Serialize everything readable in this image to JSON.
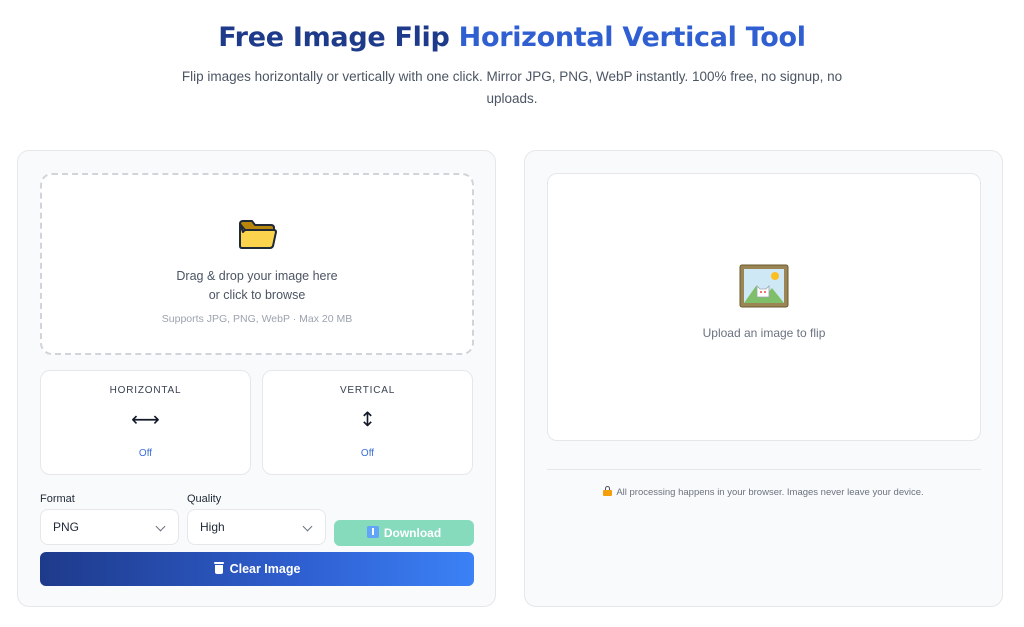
{
  "header": {
    "title_part1": "Free Image Flip ",
    "title_part2": "Horizontal Vertical Tool",
    "subtitle": "Flip images horizontally or vertically with one click. Mirror JPG, PNG, WebP instantly. 100% free, no signup, no uploads."
  },
  "upload": {
    "icon": "folder-icon",
    "line1": "Drag & drop your image here",
    "line2": "or click to browse",
    "hint": "Supports JPG, PNG, WebP · Max 20 MB"
  },
  "flip_options": [
    {
      "label": "HORIZONTAL",
      "arrow": "⟷",
      "state": "Off",
      "icon": "horizontal-arrow-icon"
    },
    {
      "label": "VERTICAL",
      "arrow": "↕",
      "state": "Off",
      "icon": "vertical-arrow-icon"
    }
  ],
  "format": {
    "label": "Format",
    "value": "PNG"
  },
  "quality": {
    "label": "Quality",
    "value": "High"
  },
  "buttons": {
    "download": "Download",
    "clear": "Clear Image"
  },
  "preview": {
    "icon": "picture-frame-icon",
    "placeholder": "Upload an image to flip"
  },
  "privacy": {
    "icon": "lock-icon",
    "text": "All processing happens in your browser. Images never leave your device."
  },
  "colors": {
    "title": "#1e3a8a",
    "accent": "#2f5fd0",
    "download_disabled": "#86dbbd",
    "state_blue": "#3b6fd6"
  }
}
